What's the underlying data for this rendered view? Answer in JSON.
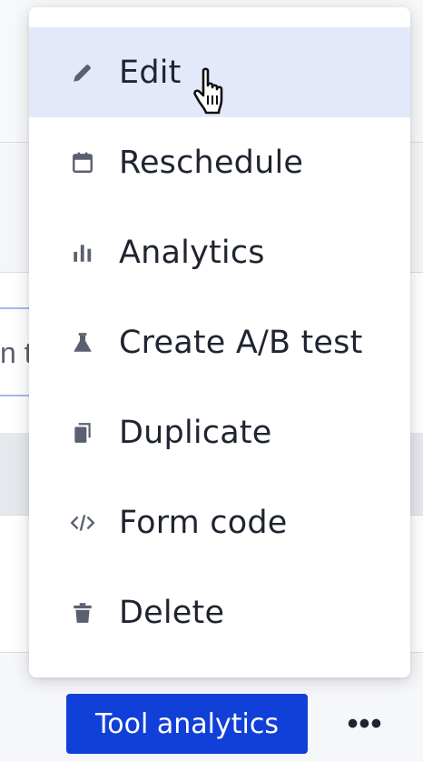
{
  "menu": {
    "items": [
      {
        "label": "Edit",
        "icon": "pencil-icon",
        "hovered": true
      },
      {
        "label": "Reschedule",
        "icon": "calendar-icon",
        "hovered": false
      },
      {
        "label": "Analytics",
        "icon": "bar-chart-icon",
        "hovered": false
      },
      {
        "label": "Create A/B test",
        "icon": "flask-icon",
        "hovered": false
      },
      {
        "label": "Duplicate",
        "icon": "copy-icon",
        "hovered": false
      },
      {
        "label": "Form code",
        "icon": "code-icon",
        "hovered": false
      },
      {
        "label": "Delete",
        "icon": "trash-icon",
        "hovered": false
      }
    ]
  },
  "background": {
    "partial_input_text": "n t"
  },
  "footer": {
    "tool_analytics_label": "Tool analytics",
    "more_label": "•••"
  },
  "colors": {
    "accent": "#1140d8",
    "hover": "#e4e8fb",
    "icon": "#5b6070",
    "text": "#1f2430"
  }
}
